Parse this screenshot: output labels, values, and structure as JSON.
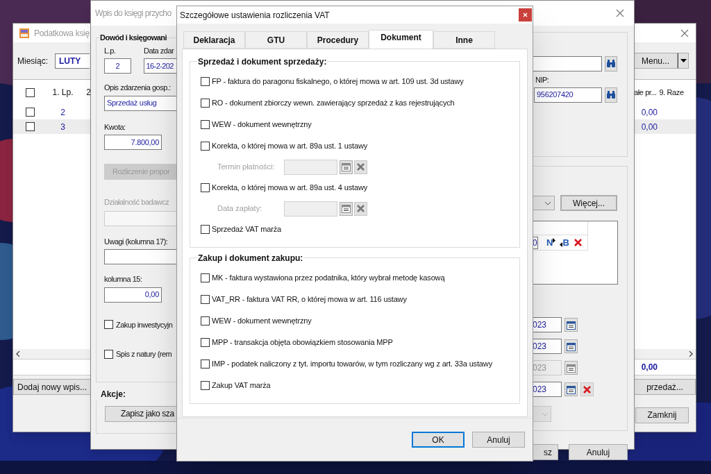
{
  "main_window": {
    "title": "Podatkowa księ",
    "month_label": "Miesiąc:",
    "month_value": "LUTY",
    "menu_button": "Menu...",
    "table": {
      "header_checked": false,
      "columns": [
        "1. Lp.",
        "2"
      ],
      "right_columns": [
        "ałe pr...",
        "9. Raze"
      ],
      "rows": [
        {
          "checked": false,
          "selected": false,
          "lp": "2",
          "value": "0,00"
        },
        {
          "checked": false,
          "selected": true,
          "lp": "3",
          "value": "0,00"
        }
      ]
    },
    "total": "0,00",
    "add_button": "Dodaj nowy wpis...",
    "sale_button": "przedaż...",
    "close_button": "Zamknij"
  },
  "entry_window": {
    "title": "Wpis do księgi przycho",
    "group_title": "Dowód i księgowani",
    "lp_label": "L.p.",
    "lp_value": "2",
    "date_label": "Data zdar",
    "date_value": "16-2-202",
    "description_label": "Opis zdarzenia gosp.:",
    "description_value": "Sprzedaż usług",
    "amount_label": "Kwota:",
    "amount_value": "7.800,00",
    "proportion_button": {
      "label": "Rozliczenie propor",
      "disabled": true
    },
    "research": {
      "label": "Działalność badawcz",
      "disabled": true
    },
    "notes_label": "Uwagi (kolumna 17):",
    "column15_label": "kolumna 15:",
    "column15_value": "0,00",
    "checkboxes": [
      {
        "label": "Zakup inwestycyjn",
        "checked": false
      },
      {
        "label": "Spis z natury (rem",
        "checked": false
      }
    ],
    "actions_title": "Akcje:",
    "template_button": "Zapisz jako sza",
    "nip_label": "NIP:",
    "nip_value": "956207420",
    "more_button": "Więcej...",
    "grid_value": "0",
    "grid_buttons": [
      "N",
      "B"
    ],
    "dates": [
      {
        "value": "023",
        "disabled": false,
        "clearable": false
      },
      {
        "value": "023",
        "disabled": false,
        "clearable": false
      },
      {
        "value": "023",
        "disabled": true,
        "clearable": false
      },
      {
        "value": "023",
        "disabled": false,
        "clearable": true
      }
    ],
    "save_button": "sz",
    "cancel_button": "Anuluj"
  },
  "vat_dialog": {
    "title": "Szczegółowe ustawienia rozliczenia VAT",
    "tabs": [
      {
        "label": "Deklaracja",
        "selected": false
      },
      {
        "label": "GTU",
        "selected": false
      },
      {
        "label": "Procedury",
        "selected": false
      },
      {
        "label": "Dokument",
        "selected": true
      },
      {
        "label": "Inne",
        "selected": false
      }
    ],
    "sections": [
      {
        "title": "Sprzedaż i dokument sprzedaży:",
        "items": [
          {
            "kind": "checkbox",
            "label": "FP - faktura do paragonu fiskalnego, o której mowa w art. 109 ust. 3d ustawy",
            "checked": false
          },
          {
            "kind": "checkbox",
            "label": "RO - dokument zbiorczy wewn. zawierający sprzedaż z kas rejestrujących",
            "checked": false
          },
          {
            "kind": "checkbox",
            "label": "WEW - dokument wewnętrzny",
            "checked": false
          },
          {
            "kind": "checkbox",
            "label": "Korekta, o której mowa w art. 89a ust. 1 ustawy",
            "checked": false
          },
          {
            "kind": "date",
            "label": "Termin płatności:",
            "disabled": true
          },
          {
            "kind": "checkbox",
            "label": "Korekta, o której mowa w art. 89a ust. 4 ustawy",
            "checked": false
          },
          {
            "kind": "date",
            "label": "Data zapłaty:",
            "disabled": true
          },
          {
            "kind": "checkbox",
            "label": "Sprzedaż VAT marża",
            "checked": false
          }
        ]
      },
      {
        "title": "Zakup i dokument zakupu:",
        "items": [
          {
            "kind": "checkbox",
            "label": "MK - faktura wystawiona przez podatnika, który wybrał metodę kasową",
            "checked": false
          },
          {
            "kind": "checkbox",
            "label": "VAT_RR - faktura VAT RR, o której mowa w art. 116 ustawy",
            "checked": false
          },
          {
            "kind": "checkbox",
            "label": "WEW - dokument wewnętrzny",
            "checked": false
          },
          {
            "kind": "checkbox",
            "label": "MPP - transakcja objęta obowiązkiem stosowania MPP",
            "checked": false
          },
          {
            "kind": "checkbox",
            "label": "IMP - podatek naliczony z tyt. importu towarów, w tym rozliczany wg z art. 33a ustawy",
            "checked": false
          },
          {
            "kind": "checkbox",
            "label": "Zakup VAT marża",
            "checked": false
          }
        ]
      }
    ],
    "buttons": [
      {
        "label": "OK",
        "default": true
      },
      {
        "label": "Anuluj",
        "default": false
      }
    ]
  }
}
